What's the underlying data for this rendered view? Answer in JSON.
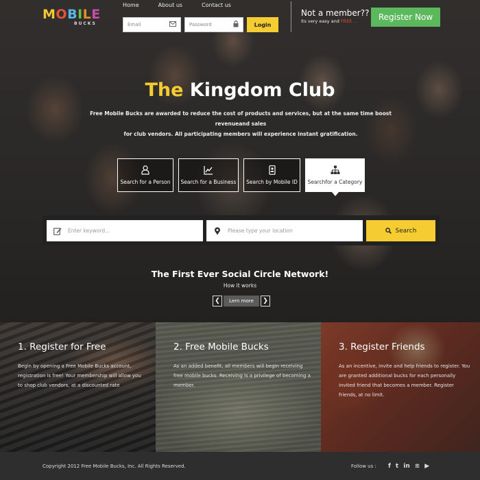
{
  "logo": {
    "word": [
      "M",
      "O",
      "B",
      "I",
      "L",
      "E"
    ],
    "sub": "BUCKS"
  },
  "nav": {
    "home": "Home",
    "about": "About us",
    "contact": "Contact us"
  },
  "login": {
    "email_placeholder": "Email",
    "password_placeholder": "Password",
    "button": "Login"
  },
  "member": {
    "question": "Not a member??",
    "tagline_prefix": "Its very easy and",
    "tagline_free": "FREE ...",
    "register": "Register Now"
  },
  "hero": {
    "title_a": "The",
    "title_b": "Kingdom Club",
    "subtitle_line1": "Free Mobile Bucks are awarded to reduce the cost of products and services, but at the same time boost revenueand sales",
    "subtitle_line2": "for club vendors. All participating members will experience instant gratification."
  },
  "search_types": [
    {
      "label": "Search for a Person",
      "icon": "person-icon"
    },
    {
      "label": "Search for a Business",
      "icon": "chart-icon"
    },
    {
      "label": "Search by Mobile ID",
      "icon": "mobile-id-icon"
    },
    {
      "label": "Searchfor a Category",
      "icon": "hierarchy-icon",
      "active": true
    }
  ],
  "search": {
    "keyword_placeholder": "Enter keyword...",
    "location_placeholder": "Please type your location",
    "button": "Search"
  },
  "social_circle": {
    "title": "The First Ever Social Circle Network!",
    "how": "How it works",
    "learn_more": "Lern more",
    "prev": "❮",
    "next": "❯"
  },
  "features": [
    {
      "title": "1. Register for Free",
      "text": "Begin by opening a Free Mobile Bucks account, registration is free! Your membership will allow you to shop club vendors, at a discounted rate"
    },
    {
      "title": "2. Free Mobile Bucks",
      "text": "As an added benefit, all members will begin receiving free mobile bucks. Receiving is a privilege of becoming a member."
    },
    {
      "title": "3. Register Friends",
      "text": "As an incentive, invite and help friends to register. You are granted additional bucks for each personally invited friend that becomes a member. Register friends, at no limit."
    }
  ],
  "footer": {
    "copyright": "Copyright 2012 Free Mobile Bucks, Inc. All Rights Reserved.",
    "follow": "Follow us :",
    "icons": [
      "facebook-icon",
      "twitter-icon",
      "linkedin-icon",
      "wifi-icon",
      "youtube-icon"
    ],
    "glyphs": [
      "f",
      "t",
      "in",
      "≋",
      "▶"
    ]
  },
  "colors": {
    "accent_yellow": "#f5cd33",
    "register_green": "#5cb85c",
    "free_red": "#e5442f"
  }
}
